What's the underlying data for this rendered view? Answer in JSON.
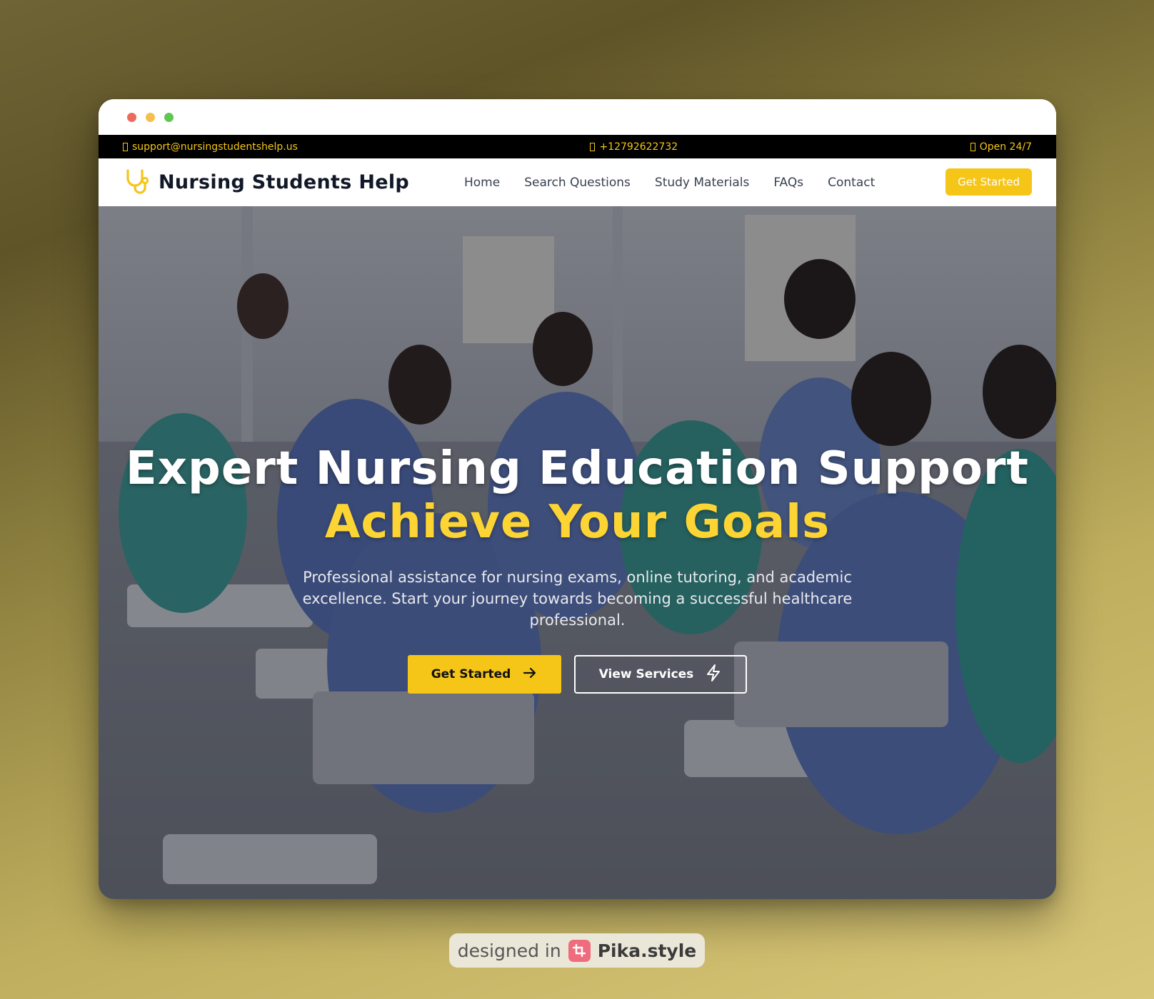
{
  "topbar": {
    "email": "support@nursingstudentshelp.us",
    "phone": "+12792622732",
    "hours": "Open 24/7"
  },
  "navbar": {
    "brand": "Nursing Students Help",
    "links": [
      "Home",
      "Search Questions",
      "Study Materials",
      "FAQs",
      "Contact"
    ],
    "cta": "Get Started"
  },
  "hero": {
    "title": "Expert Nursing Education Support",
    "accent": "Achieve Your Goals",
    "subtitle": "Professional assistance for nursing exams, online tutoring, and academic excellence. Start your journey towards becoming a successful healthcare professional.",
    "primary_button": "Get Started",
    "secondary_button": "View Services",
    "image_alt": "nursing students in a classroom"
  },
  "badge": {
    "prefix": "designed in",
    "brand": "Pika.style"
  },
  "colors": {
    "accent": "#f5c518",
    "accent_text": "#fcd535",
    "topbar_bg": "#000000",
    "brand_text": "#111827"
  },
  "icons": {
    "brand": "stethoscope-icon",
    "email": "envelope-icon",
    "phone": "phone-icon",
    "hours": "clock-icon",
    "primary_button": "arrow-right-icon",
    "secondary_button": "lightning-icon",
    "badge": "crop-icon"
  }
}
